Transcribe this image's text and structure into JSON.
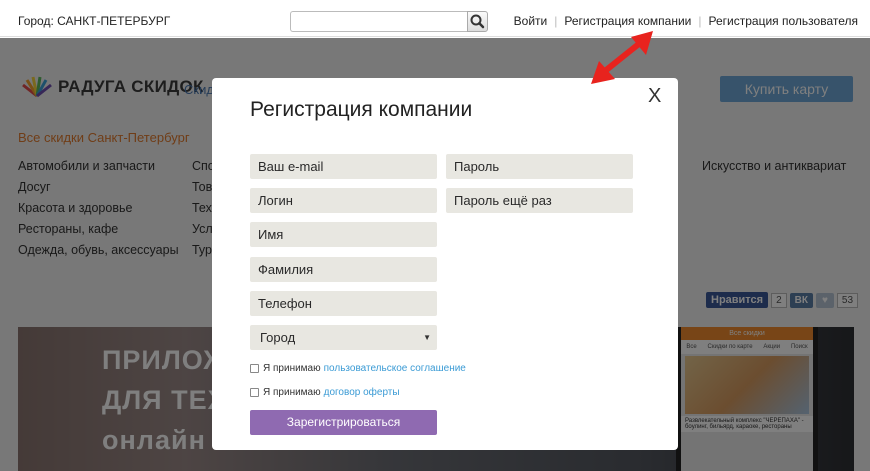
{
  "topbar": {
    "city_label": "Город: САНКТ-ПЕТЕРБУРГ",
    "search_placeholder": "",
    "links": [
      "Войти",
      "Регистрация компании",
      "Регистрация пользователя"
    ]
  },
  "background": {
    "logo_text": "РАДУГА СКИДОК",
    "logo_tail": "Скид",
    "buy_card": "Купить карту",
    "all_discounts": "Все скидки Санкт-Петербург",
    "categories_col1": [
      "Автомобили и запчасти",
      "Досуг",
      "Красота и здоровье",
      "Рестораны, кафе",
      "Одежда, обувь, аксессуары"
    ],
    "categories_col2": [
      "Спо",
      "Тов",
      "Техн",
      "Усл",
      "Тур"
    ],
    "categories_col3": [
      "Искусство и антиквариат"
    ],
    "social": {
      "fb_label": "Нравится",
      "fb_count": "2",
      "vk_label": "ВК",
      "heart_count": "53"
    },
    "banner_lines": [
      "ПРИЛОЖ",
      "ДЛЯ ТЕХ",
      "онлайн"
    ],
    "phone": {
      "header": "Все скидки",
      "tabs": [
        "Все",
        "Скидки по карте",
        "Акции",
        "Поиск"
      ],
      "caption": "Развлекательный комплекс \"ЧЕРЕПАХА\" - боулинг, бильярд, караоке, рестораны"
    }
  },
  "modal": {
    "title": "Регистрация компании",
    "close_label": "X",
    "fields_left": [
      "Ваш e-mail",
      "Логин",
      "Имя",
      "Фамилия",
      "Телефон"
    ],
    "fields_right": [
      "Пароль",
      "Пароль ещё раз"
    ],
    "city_select": "Город",
    "agree_1": {
      "text": "Я принимаю",
      "link": "пользовательское соглашение"
    },
    "agree_2": {
      "text": "Я принимаю",
      "link": "договор оферты"
    },
    "submit_label": "Зарегистрироваться"
  },
  "colors": {
    "submit": "#8f6ab1",
    "link": "#3b9bd5",
    "annotation_arrow": "#e8231e"
  }
}
